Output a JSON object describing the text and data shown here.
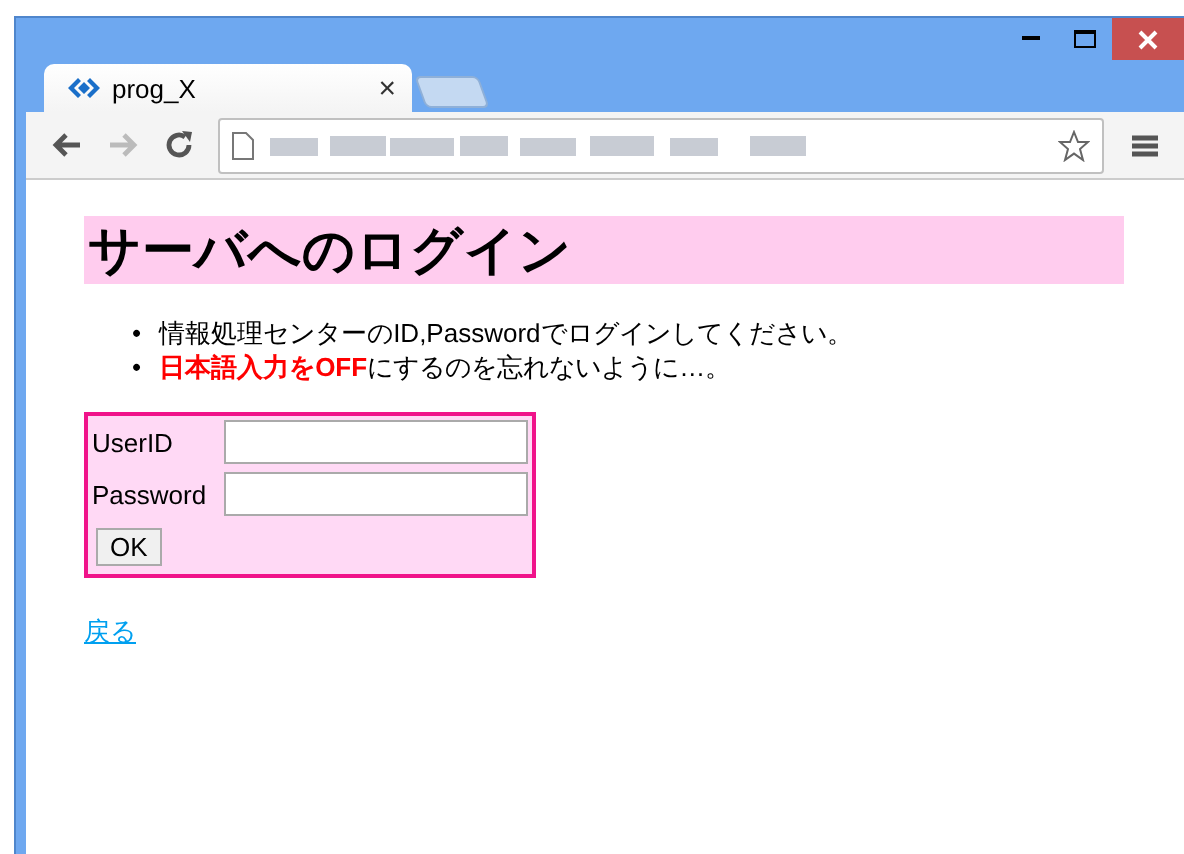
{
  "window": {
    "tab": {
      "title": "prog_X",
      "close": "×"
    }
  },
  "page": {
    "heading": "サーバへのログイン",
    "notes": [
      {
        "bullet": "•",
        "text": "情報処理センターのID,Passwordでログインしてください。"
      },
      {
        "bullet": "•",
        "text": "**日本語入力をOFF**にするのを忘れないように…。"
      }
    ],
    "form": {
      "fields": [
        {
          "label": "UserID"
        },
        {
          "label": "Password"
        }
      ],
      "submit": "OK"
    },
    "back_link": "戻る"
  }
}
